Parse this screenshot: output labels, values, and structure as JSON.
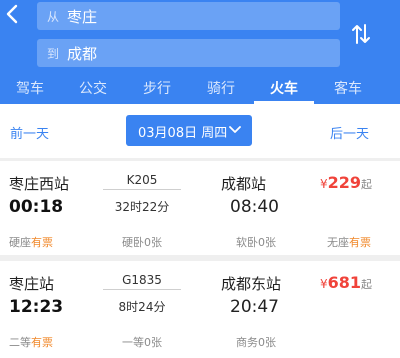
{
  "search": {
    "from_prefix": "从",
    "from_value": "枣庄",
    "to_prefix": "到",
    "to_value": "成都"
  },
  "tabs": [
    "驾车",
    "公交",
    "步行",
    "骑行",
    "火车",
    "客车"
  ],
  "active_tab": "火车",
  "date_bar": {
    "prev": "前一天",
    "date": "03月08日 周四",
    "next": "后一天"
  },
  "trains": [
    {
      "from_station": "枣庄西站",
      "depart_time": "00:18",
      "train_no": "K205",
      "duration": "32时22分",
      "to_station": "成都站",
      "arrive_time": "08:40",
      "price_symbol": "¥",
      "price": "229",
      "price_suffix": "起",
      "seats": [
        {
          "name": "硬座",
          "status": "有票"
        },
        {
          "name": "硬卧",
          "status": "0张"
        },
        {
          "name": "软卧",
          "status": "0张"
        },
        {
          "name": "无座",
          "status": "有票"
        }
      ]
    },
    {
      "from_station": "枣庄站",
      "depart_time": "12:23",
      "train_no": "G1835",
      "duration": "8时24分",
      "to_station": "成都东站",
      "arrive_time": "20:47",
      "price_symbol": "¥",
      "price": "681",
      "price_suffix": "起",
      "seats": [
        {
          "name": "二等",
          "status": "有票"
        },
        {
          "name": "一等",
          "status": "0张"
        },
        {
          "name": "商务",
          "status": "0张"
        }
      ]
    }
  ],
  "colors": {
    "brand_blue": "#3a83f1",
    "price_red": "#f0433a",
    "available_orange": "#f0882a"
  }
}
